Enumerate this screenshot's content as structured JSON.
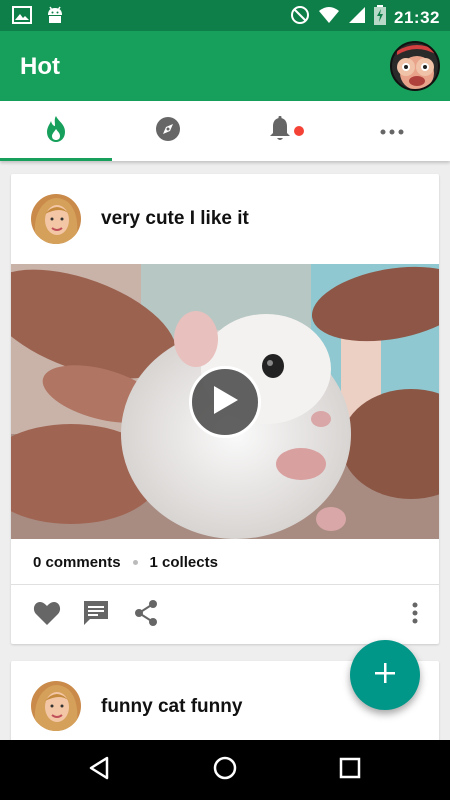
{
  "status_bar": {
    "time": "21:32",
    "icons": [
      "gallery-icon",
      "android-icon",
      "do-not-disturb-icon",
      "wifi-icon",
      "signal-icon",
      "battery-charging-icon"
    ]
  },
  "app_bar": {
    "title": "Hot",
    "profile_avatar": "profile-avatar"
  },
  "tabs": [
    {
      "name": "hot",
      "icon": "flame-icon",
      "active": true
    },
    {
      "name": "explore",
      "icon": "compass-icon",
      "active": false
    },
    {
      "name": "notifications",
      "icon": "bell-icon",
      "active": false,
      "badge": true
    },
    {
      "name": "more",
      "icon": "more-horizontal-icon",
      "active": false
    }
  ],
  "posts": [
    {
      "title": "very cute I like it",
      "comments": "0 comments",
      "collects": "1 collects",
      "media": "video",
      "actions": [
        "heart-icon",
        "comment-icon",
        "share-icon",
        "more-vertical-icon"
      ]
    },
    {
      "title": "funny cat funny"
    }
  ],
  "fab": {
    "icon": "plus-icon"
  },
  "nav_bar": [
    "back-icon",
    "home-icon",
    "recents-icon"
  ],
  "colors": {
    "primary": "#16a05b",
    "primary_dark": "#0f7f49",
    "accent": "#009688",
    "badge": "#f44336"
  }
}
